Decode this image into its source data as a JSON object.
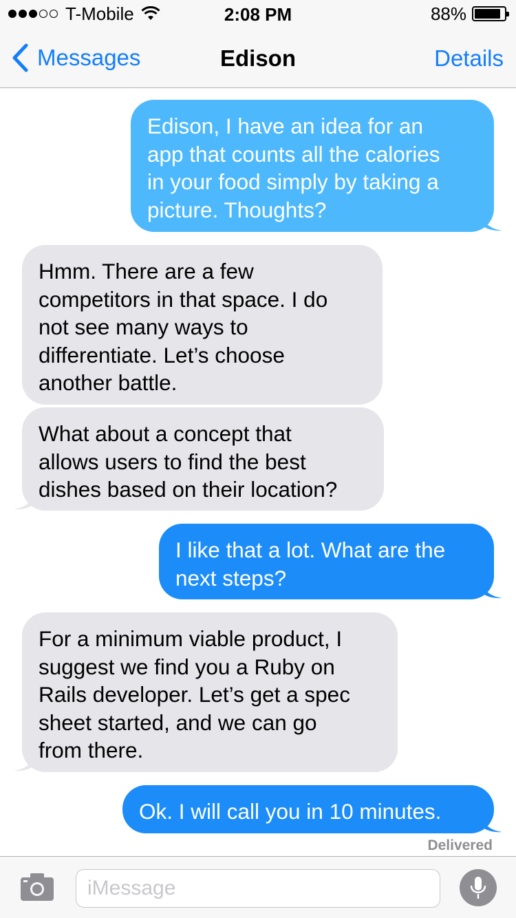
{
  "status_bar": {
    "carrier": "T-Mobile",
    "signal_bars_filled": 3,
    "signal_bars_total": 5,
    "time": "2:08 PM",
    "battery_percent": "88%",
    "battery_level": 0.88
  },
  "nav": {
    "back_label": "Messages",
    "title": "Edison",
    "details_label": "Details"
  },
  "messages": [
    {
      "direction": "outgoing",
      "text": "Edison, I have an idea for an\napp that counts all the calories\nin your food simply by taking a\npicture. Thoughts?"
    },
    {
      "direction": "incoming",
      "text": "Hmm. There are a few\ncompetitors in that space. I do\nnot see many ways to\ndifferentiate. Let’s choose\nanother battle."
    },
    {
      "direction": "incoming",
      "text": "What about a concept that\nallows users to find the best\ndishes based on their location?"
    },
    {
      "direction": "outgoing",
      "text": "I like that a lot. What are the\nnext steps?"
    },
    {
      "direction": "incoming",
      "text": "For a minimum viable product, I\nsuggest we find you a Ruby on\nRails developer. Let’s get a spec\nsheet started, and we can go\nfrom there."
    },
    {
      "direction": "outgoing",
      "text": "Ok. I will call you in 10 minutes."
    }
  ],
  "delivered_label": "Delivered",
  "input": {
    "placeholder": "iMessage",
    "value": ""
  },
  "icons": {
    "camera": "camera-icon",
    "mic": "microphone-icon",
    "back": "chevron-left-icon",
    "wifi": "wifi-icon",
    "battery": "battery-icon"
  },
  "colors": {
    "accent": "#147efb",
    "outgoing_bubble": "#1c8cf9",
    "outgoing_bubble_top": "#4db8fb",
    "incoming_bubble": "#e5e5ea",
    "bars": "#f7f7f7"
  }
}
